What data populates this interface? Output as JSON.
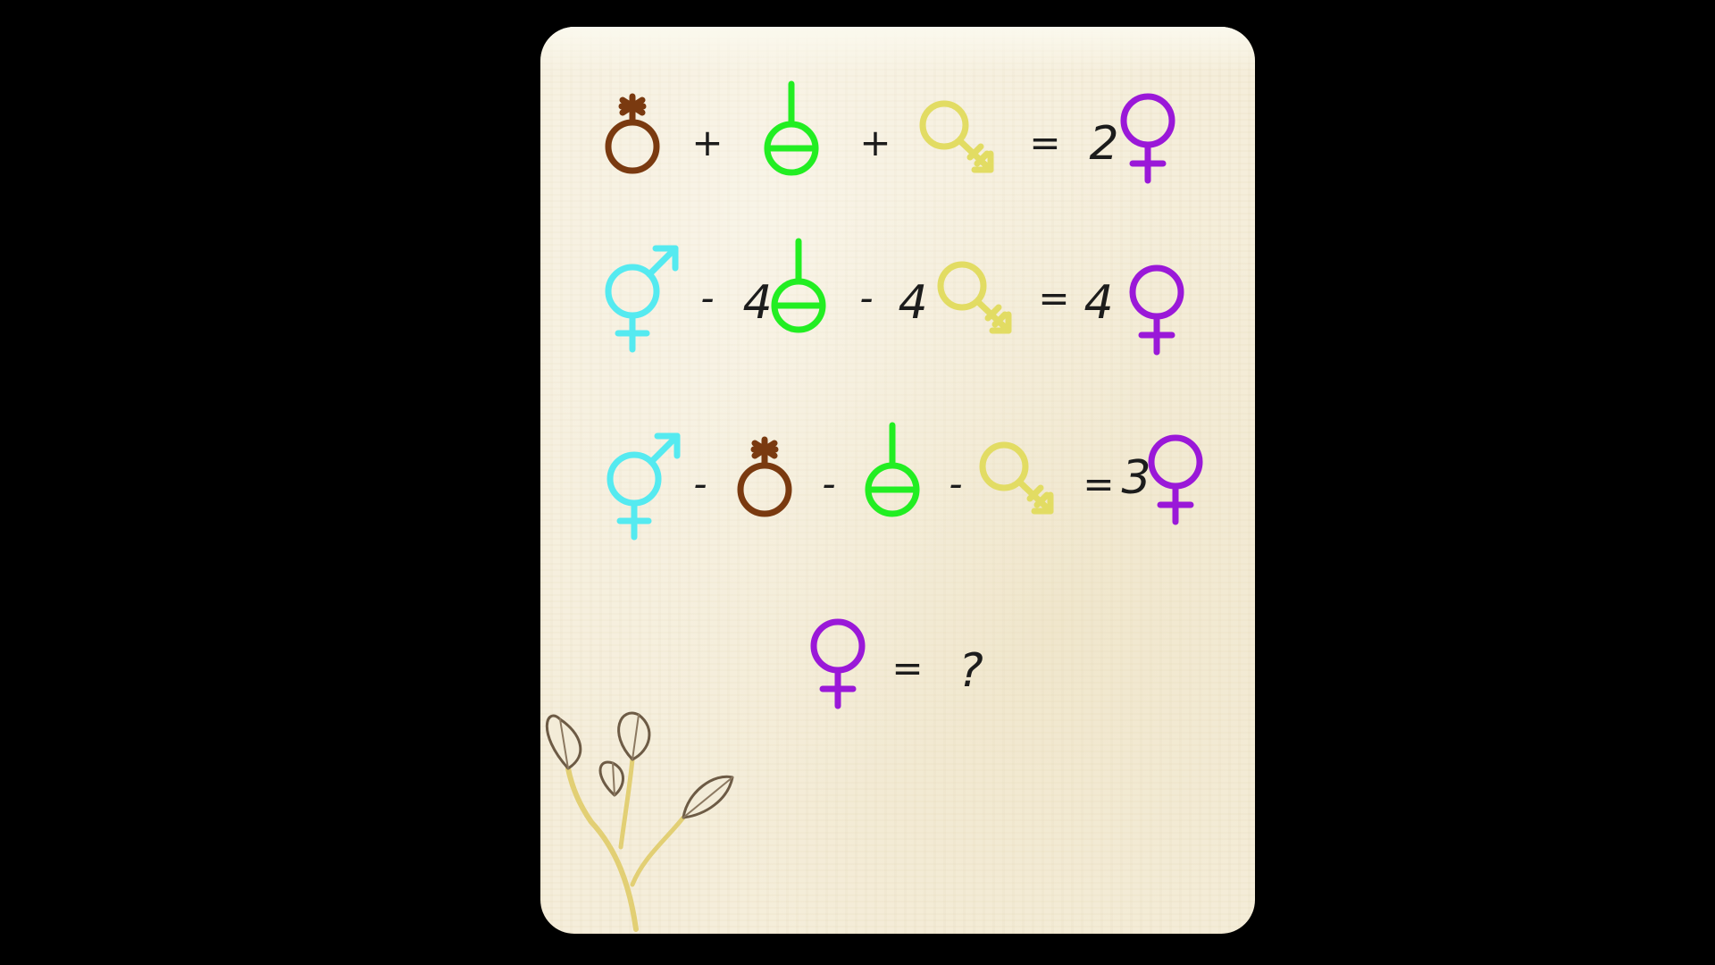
{
  "puzzle": {
    "row1": {
      "op1": "+",
      "op2": "+",
      "eq": "=",
      "coef": "2"
    },
    "row2": {
      "op1": "-",
      "coef1": "4",
      "op2": "-",
      "coef2": "4",
      "eq": "=",
      "coef3": "4"
    },
    "row3": {
      "op1": "-",
      "op2": "-",
      "op3": "-",
      "eq": "=",
      "coef": "3"
    },
    "question": {
      "eq": "=",
      "mark": "?"
    }
  },
  "symbols": {
    "brown-ring": {
      "name": "ring-with-asterisk-icon",
      "color": "#7a3a10"
    },
    "green-circle": {
      "name": "circle-with-bar-stem-icon",
      "color": "#22ee22"
    },
    "yellow-key": {
      "name": "key-arrow-icon",
      "color": "#e2dc63"
    },
    "purple-venus": {
      "name": "venus-icon",
      "color": "#9a18d8"
    },
    "cyan-transgender": {
      "name": "mars-venus-icon",
      "color": "#55eaf0"
    }
  },
  "decor": {
    "leaf_sprig": "leaf-sprig-icon"
  }
}
